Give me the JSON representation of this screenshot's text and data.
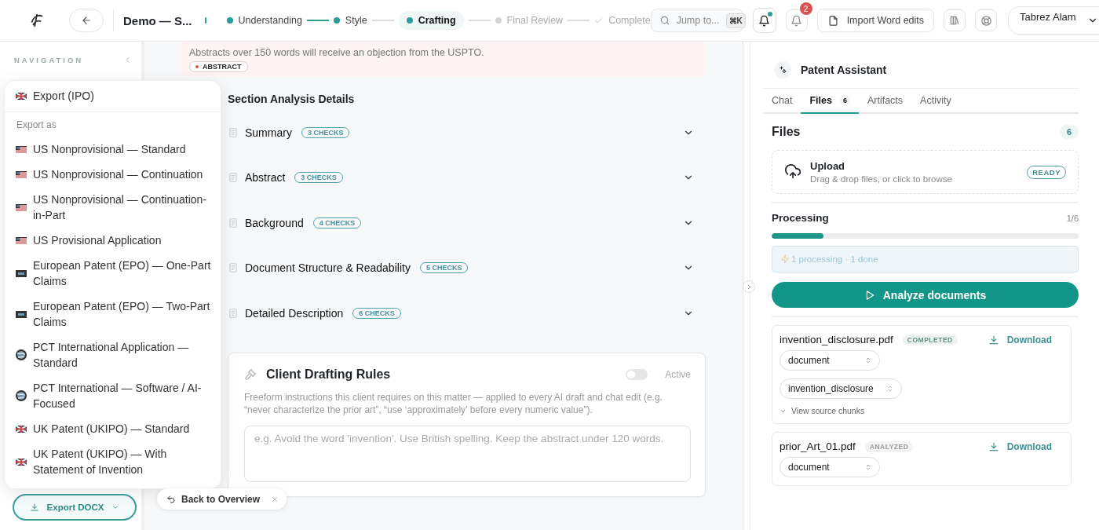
{
  "topbar": {
    "title": "Demo — S...",
    "steps": [
      {
        "label": "Understanding",
        "done": true,
        "selected": false,
        "kind": "dot"
      },
      {
        "label": "Style",
        "done": true,
        "selected": false,
        "kind": "dot"
      },
      {
        "label": "Crafting",
        "done": false,
        "selected": true,
        "kind": "dot"
      },
      {
        "label": "Final Review",
        "done": false,
        "selected": false,
        "kind": "dot"
      },
      {
        "label": "Complete",
        "done": false,
        "selected": false,
        "kind": "check"
      }
    ],
    "search": {
      "placeholder": "Jump to...",
      "shortcut": "⌘K"
    },
    "notifications": {
      "unread": true
    },
    "alerts": {
      "count": "2"
    },
    "import_button": "Import Word edits",
    "user": "Tabrez Alam"
  },
  "sidebar": {
    "heading": "NAVIGATION",
    "export_button": "Export DOCX"
  },
  "export_menu": {
    "title": "Export (IPO)",
    "section_label": "Export as",
    "items": [
      {
        "label": "US Nonprovisional — Standard",
        "kind": "us"
      },
      {
        "label": "US Nonprovisional — Continuation",
        "kind": "us"
      },
      {
        "label": "US Nonprovisional — Continuation-in-Part",
        "kind": "us"
      },
      {
        "label": "US Provisional Application",
        "kind": "us"
      },
      {
        "label": "European Patent (EPO) — One-Part Claims",
        "kind": "ep"
      },
      {
        "label": "European Patent (EPO) — Two-Part Claims",
        "kind": "ep"
      },
      {
        "label": "PCT International Application — Standard",
        "kind": "pct"
      },
      {
        "label": "PCT International — Software / AI-Focused",
        "kind": "pct"
      },
      {
        "label": "UK Patent (UKIPO) — Standard",
        "kind": "uk"
      },
      {
        "label": "UK Patent (UKIPO) — With Statement of Invention",
        "kind": "uk"
      }
    ]
  },
  "center": {
    "alert": {
      "text": "Abstracts over 150 words will receive an objection from the USPTO.",
      "tag": "ABSTRACT"
    },
    "analysis": {
      "title": "Section Analysis Details",
      "sections": [
        {
          "title": "Summary",
          "badge": "3 CHECKS",
          "expanded": false
        },
        {
          "title": "Abstract",
          "badge": "3 CHECKS",
          "expanded": false
        },
        {
          "title": "Background",
          "badge": "4 CHECKS",
          "expanded": false
        },
        {
          "title": "Document Structure & Readability",
          "badge": "5 CHECKS",
          "expanded": false
        },
        {
          "title": "Detailed Description",
          "badge": "6 CHECKS",
          "expanded": false
        }
      ]
    },
    "rules": {
      "title": "Client Drafting Rules",
      "toggle_label": "Active",
      "on": false,
      "description": "Freeform instructions this client requires on this matter — applied to every AI draft and chat edit (e.g. “never characterize the prior art”, “use ‘approximately’ before every numeric value”).",
      "placeholder": "e.g. Avoid the word 'invention'. Use British spelling. Keep the abstract under 120 words."
    },
    "back_button": "Back to Overview"
  },
  "assistant": {
    "title": "Patent Assistant",
    "tabs": [
      {
        "label": "Chat",
        "selected": false
      },
      {
        "label": "Files",
        "count": "6",
        "selected": true
      },
      {
        "label": "Artifacts",
        "selected": false
      },
      {
        "label": "Activity",
        "selected": false
      }
    ],
    "files_heading": "Files",
    "files_count": "6",
    "upload": {
      "title": "Upload",
      "hint": "Drag & drop files, or click to browse",
      "status": "READY"
    },
    "processing": {
      "title": "Processing",
      "count": "1/6",
      "level": 0.17,
      "summary": "1 processing · 1 done"
    },
    "analyze_button": "Analyze documents",
    "files": [
      {
        "name": "invention_disclosure.pdf",
        "status": "COMPLETED",
        "kind": "completed",
        "download": "Download",
        "selects": [
          "document",
          "invention_disclosure"
        ],
        "chunks_link": "View source chunks"
      },
      {
        "name": "prior_Art_01.pdf",
        "status": "ANALYZED",
        "kind": "analyzed",
        "download": "Download",
        "selects": [
          "document"
        ]
      }
    ]
  }
}
